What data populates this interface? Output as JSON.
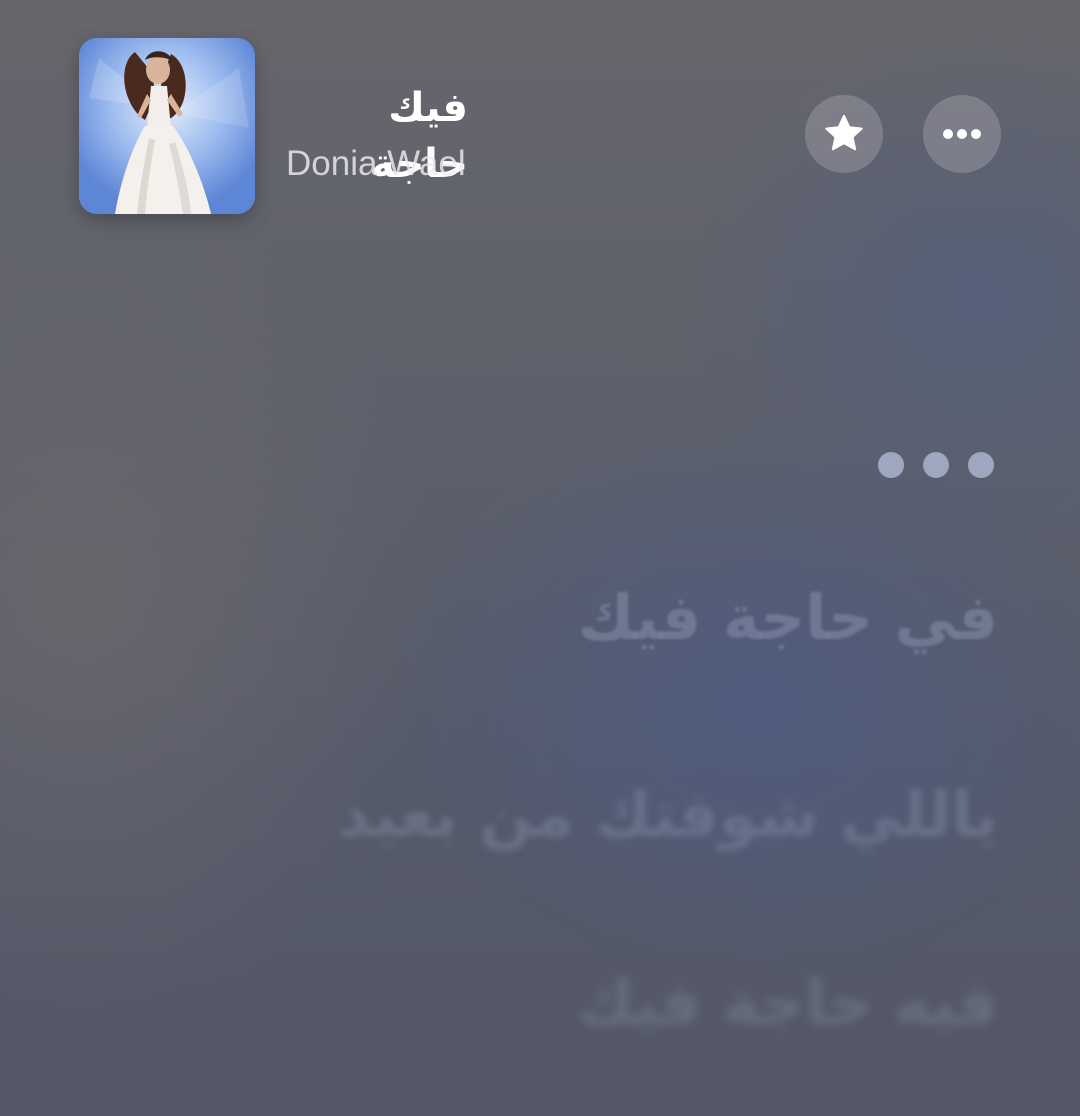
{
  "now_playing": {
    "title": "فيك حاجة",
    "artist": "Donia Wael",
    "artwork_icon": "album-artwork"
  },
  "actions": {
    "favorite_icon": "star-icon",
    "more_icon": "ellipsis-icon"
  },
  "lyrics": {
    "interlude_icon": "three-dots-interlude",
    "lines": [
      "في حاجة فيك",
      "ياللي شوفتك من بعيد",
      "فيه حاجة فيك"
    ]
  },
  "colors": {
    "background": "#5c5f6b",
    "button_fill": "#9a9aa2",
    "lyric_dim": "#96a0b9"
  }
}
